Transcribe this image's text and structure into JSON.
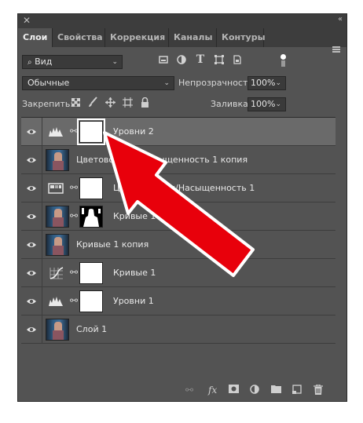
{
  "tabs": [
    "Слои",
    "Свойства",
    "Коррекция",
    "Каналы",
    "Контуры"
  ],
  "filter": {
    "label": "Вид"
  },
  "blend_mode": "Обычные",
  "opacity": {
    "label": "Непрозрачность:",
    "value": "100%"
  },
  "lock": {
    "label": "Закрепить:"
  },
  "fill": {
    "label": "Заливка:",
    "value": "100%"
  },
  "layers": [
    {
      "name": "Уровни 2"
    },
    {
      "name": "Цветовой тон/Насыщенность 1 копия"
    },
    {
      "name": "Цветовой тон/Насыщенность 1"
    },
    {
      "name": "Кривые 1 копия"
    },
    {
      "name": "Кривые 1 копия"
    },
    {
      "name": "Кривые 1"
    },
    {
      "name": "Уровни 1"
    },
    {
      "name": "Слой 1"
    }
  ],
  "bottom_icons": [
    "link-icon",
    "fx-icon",
    "mask-icon",
    "adjustment-icon",
    "folder-icon",
    "new-layer-icon",
    "trash-icon"
  ],
  "colors": {
    "panel": "#535353",
    "tabbar": "#3d3d3d",
    "selected_layer": "#6a6a6a",
    "arrow": "#e8000b"
  }
}
